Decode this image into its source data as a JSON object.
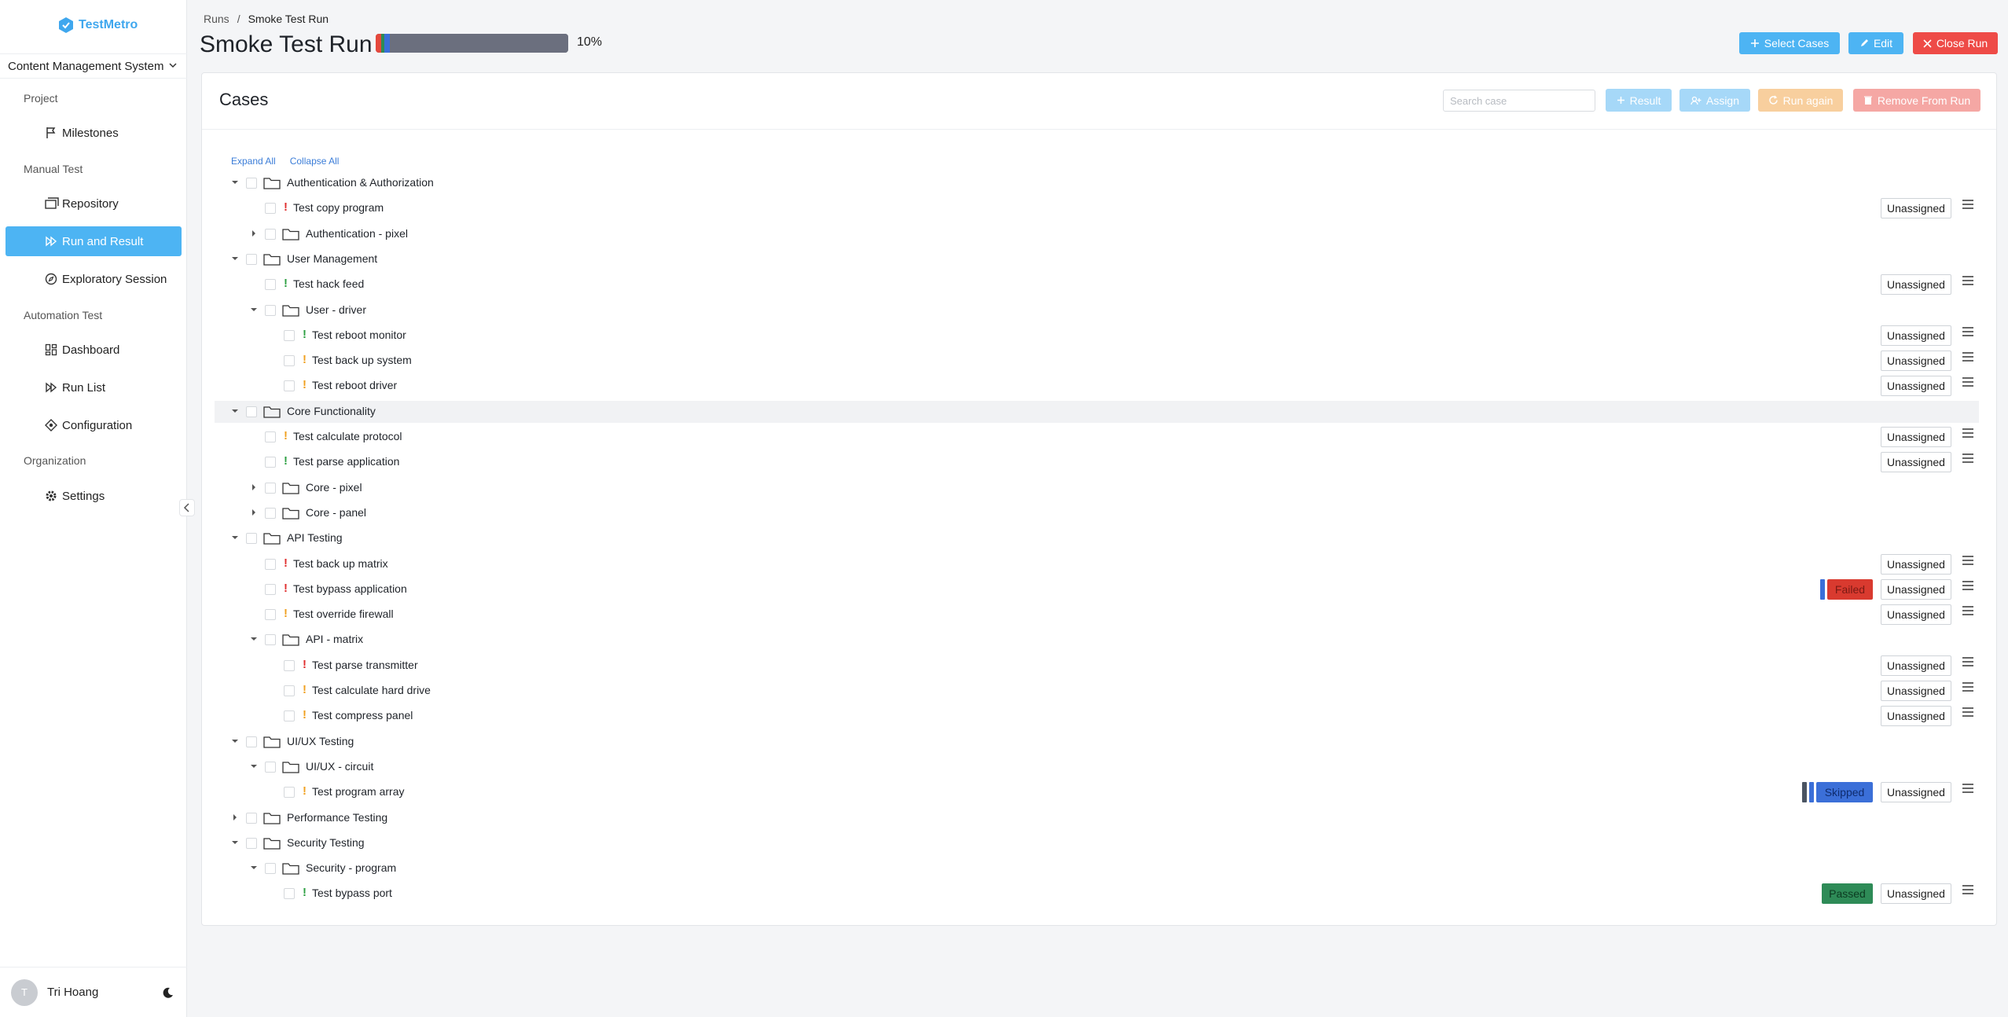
{
  "app": {
    "name": "TestMetro",
    "project": "Content Management System"
  },
  "sidebar": {
    "sections": {
      "project": "Project",
      "manual": "Manual Test",
      "automation": "Automation Test",
      "organization": "Organization"
    },
    "items": {
      "milestones": "Milestones",
      "repository": "Repository",
      "run_and_result": "Run and Result",
      "exploratory": "Exploratory Session",
      "dashboard": "Dashboard",
      "run_list": "Run List",
      "configuration": "Configuration",
      "settings": "Settings"
    },
    "active_item": "run_and_result",
    "user": {
      "initial": "T",
      "name": "Tri Hoang"
    }
  },
  "header": {
    "breadcrumb": {
      "root": "Runs",
      "separator": "/",
      "current": "Smoke Test Run"
    },
    "title": "Smoke Test Run",
    "progress": {
      "text": "10%",
      "value_percent": 10,
      "segments": [
        {
          "status": "failed",
          "percent": 2.8,
          "color": "#e5483d"
        },
        {
          "status": "passed",
          "percent": 1.6,
          "color": "#2e8b57"
        },
        {
          "status": "skipped",
          "percent": 2.8,
          "color": "#3b6fd8"
        },
        {
          "status": "untested",
          "percent": 92.8,
          "color": "#6b6f7e"
        }
      ]
    },
    "buttons": {
      "select_cases": "Select Cases",
      "edit": "Edit",
      "close_run": "Close Run"
    }
  },
  "cases": {
    "title": "Cases",
    "search_placeholder": "Search case",
    "actions": {
      "result": "Result",
      "assign": "Assign",
      "run_again": "Run again",
      "remove": "Remove From Run"
    },
    "expand_all": "Expand All",
    "collapse_all": "Collapse All",
    "unassigned_label": "Unassigned",
    "status_labels": {
      "failed": "Failed",
      "skipped": "Skipped",
      "passed": "Passed"
    },
    "priority_colors": {
      "high": "#e02f2f",
      "medium": "#f0a020",
      "low": "#2ea043"
    },
    "rows": [
      {
        "type": "folder",
        "level": 0,
        "expanded": true,
        "label": "Authentication & Authorization"
      },
      {
        "type": "case",
        "level": 1,
        "priority": "high",
        "label": "Test copy program"
      },
      {
        "type": "folder",
        "level": 1,
        "expanded": false,
        "label": "Authentication - pixel"
      },
      {
        "type": "folder",
        "level": 0,
        "expanded": true,
        "label": "User Management"
      },
      {
        "type": "case",
        "level": 1,
        "priority": "low",
        "label": "Test hack feed"
      },
      {
        "type": "folder",
        "level": 1,
        "expanded": true,
        "label": "User - driver"
      },
      {
        "type": "case",
        "level": 2,
        "priority": "low",
        "label": "Test reboot monitor"
      },
      {
        "type": "case",
        "level": 2,
        "priority": "medium",
        "label": "Test back up system"
      },
      {
        "type": "case",
        "level": 2,
        "priority": "medium",
        "label": "Test reboot driver"
      },
      {
        "type": "folder",
        "level": 0,
        "expanded": true,
        "label": "Core Functionality",
        "highlight": true
      },
      {
        "type": "case",
        "level": 1,
        "priority": "medium",
        "label": "Test calculate protocol"
      },
      {
        "type": "case",
        "level": 1,
        "priority": "low",
        "label": "Test parse application"
      },
      {
        "type": "folder",
        "level": 1,
        "expanded": false,
        "label": "Core - pixel"
      },
      {
        "type": "folder",
        "level": 1,
        "expanded": false,
        "label": "Core - panel"
      },
      {
        "type": "folder",
        "level": 0,
        "expanded": true,
        "label": "API Testing"
      },
      {
        "type": "case",
        "level": 1,
        "priority": "high",
        "label": "Test back up matrix"
      },
      {
        "type": "case",
        "level": 1,
        "priority": "high",
        "label": "Test bypass application",
        "status": "failed",
        "history": [
          "#3b6fd8"
        ]
      },
      {
        "type": "case",
        "level": 1,
        "priority": "medium",
        "label": "Test override firewall"
      },
      {
        "type": "folder",
        "level": 1,
        "expanded": true,
        "label": "API - matrix"
      },
      {
        "type": "case",
        "level": 2,
        "priority": "high",
        "label": "Test parse transmitter"
      },
      {
        "type": "case",
        "level": 2,
        "priority": "medium",
        "label": "Test calculate hard drive"
      },
      {
        "type": "case",
        "level": 2,
        "priority": "medium",
        "label": "Test compress panel"
      },
      {
        "type": "folder",
        "level": 0,
        "expanded": true,
        "label": "UI/UX Testing"
      },
      {
        "type": "folder",
        "level": 1,
        "expanded": true,
        "label": "UI/UX - circuit"
      },
      {
        "type": "case",
        "level": 2,
        "priority": "medium",
        "label": "Test program array",
        "status": "skipped",
        "history": [
          "#4b5563",
          "#3b6fd8"
        ]
      },
      {
        "type": "folder",
        "level": 0,
        "expanded": false,
        "label": "Performance Testing"
      },
      {
        "type": "folder",
        "level": 0,
        "expanded": true,
        "label": "Security Testing"
      },
      {
        "type": "folder",
        "level": 1,
        "expanded": true,
        "label": "Security - program"
      },
      {
        "type": "case",
        "level": 2,
        "priority": "low",
        "label": "Test bypass port",
        "status": "passed",
        "history": []
      }
    ]
  }
}
